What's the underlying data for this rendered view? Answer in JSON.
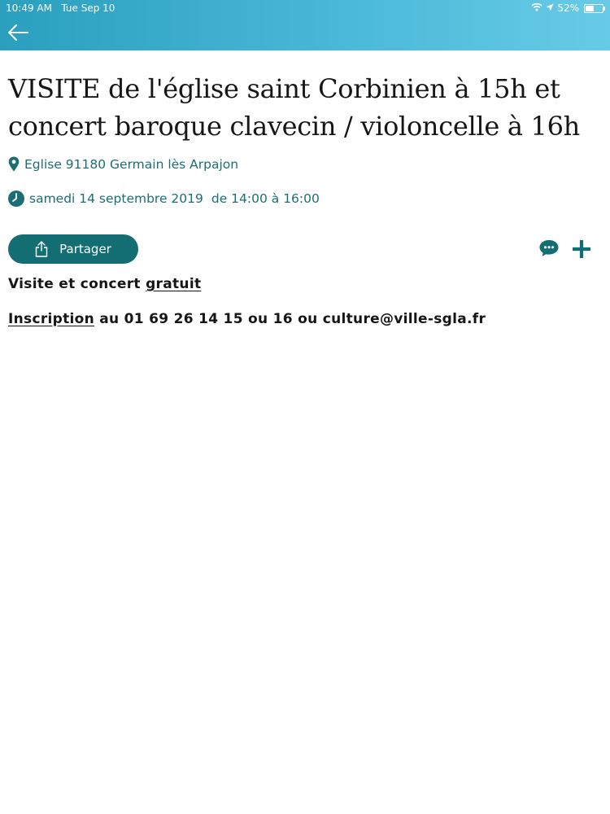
{
  "status_bar": {
    "time": "10:49 AM",
    "date": "Tue Sep 10",
    "battery_percent": "52%",
    "battery_level": 0.52
  },
  "header": {
    "back_icon": "arrow-left-icon",
    "background_colors": [
      "#2a9fbe",
      "#67cbe6"
    ]
  },
  "event": {
    "title": "VISITE de l'église saint Corbinien à 15h et concert baroque clavecin / violoncelle à 16h",
    "location": "Eglise 91180 Germain lès Arpajon",
    "location_icon": "map-pin-icon",
    "date": "samedi 14 septembre 2019",
    "time_range": "de 14:00 à 16:00",
    "date_icon": "clock-icon"
  },
  "actions": {
    "share_label": "Partager",
    "share_icon": "share-icon",
    "comment_icon": "comment-icon",
    "add_icon": "plus-icon",
    "accent_color": "#136e73"
  },
  "description": {
    "line1_text": "Visite et concert ",
    "line1_link": "gratuit",
    "line2_link": "Inscription",
    "line2_text": " au 01 69 26 14 15 ou 16 ou culture@ville-sgla.fr"
  }
}
